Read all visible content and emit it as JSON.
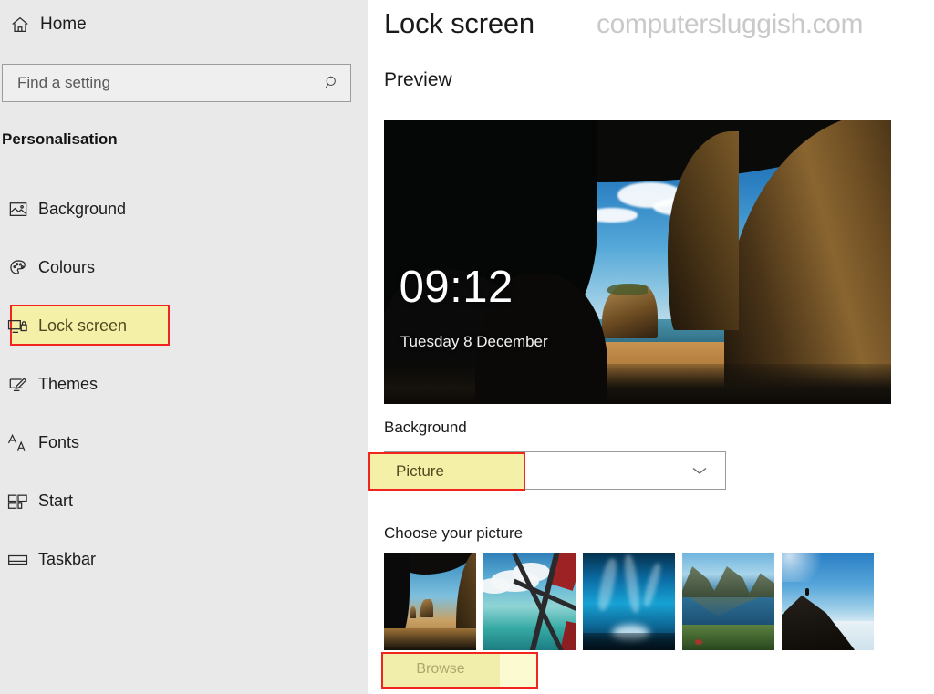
{
  "sidebar": {
    "home": {
      "label": "Home",
      "icon": "home-icon"
    },
    "search": {
      "placeholder": "Find a setting",
      "value": "",
      "icon": "search-icon"
    },
    "section_title": "Personalisation",
    "items": [
      {
        "label": "Background",
        "icon": "picture-icon",
        "selected": false
      },
      {
        "label": "Colours",
        "icon": "palette-icon",
        "selected": false
      },
      {
        "label": "Lock screen",
        "icon": "monitor-lock-icon",
        "selected": true
      },
      {
        "label": "Themes",
        "icon": "monitor-brush-icon",
        "selected": false
      },
      {
        "label": "Fonts",
        "icon": "font-size-icon",
        "selected": false
      },
      {
        "label": "Start",
        "icon": "start-tiles-icon",
        "selected": false
      },
      {
        "label": "Taskbar",
        "icon": "taskbar-icon",
        "selected": false
      }
    ]
  },
  "main": {
    "page_title": "Lock screen",
    "watermark": "computersluggish.com",
    "preview_label": "Preview",
    "preview": {
      "time": "09:12",
      "date": "Tuesday 8 December"
    },
    "background_section": {
      "label": "Background",
      "dropdown_value": "Picture",
      "chevron_icon": "chevron-down-icon"
    },
    "choose_picture": {
      "label": "Choose your picture",
      "thumbnails": [
        {
          "name": "cave-beach-thumbnail"
        },
        {
          "name": "lagoon-sailboat-thumbnail"
        },
        {
          "name": "ice-cave-thumbnail"
        },
        {
          "name": "mountain-lake-thumbnail"
        },
        {
          "name": "ridge-clouds-thumbnail"
        }
      ],
      "browse_label": "Browse"
    }
  },
  "colors": {
    "sidebar_bg": "#e9e9e9",
    "main_bg": "#ffffff",
    "highlight_fill": "#f5f0a8",
    "highlight_border": "#f2241f",
    "text_primary": "#1a1a1a",
    "watermark": "#c9c9c9"
  }
}
